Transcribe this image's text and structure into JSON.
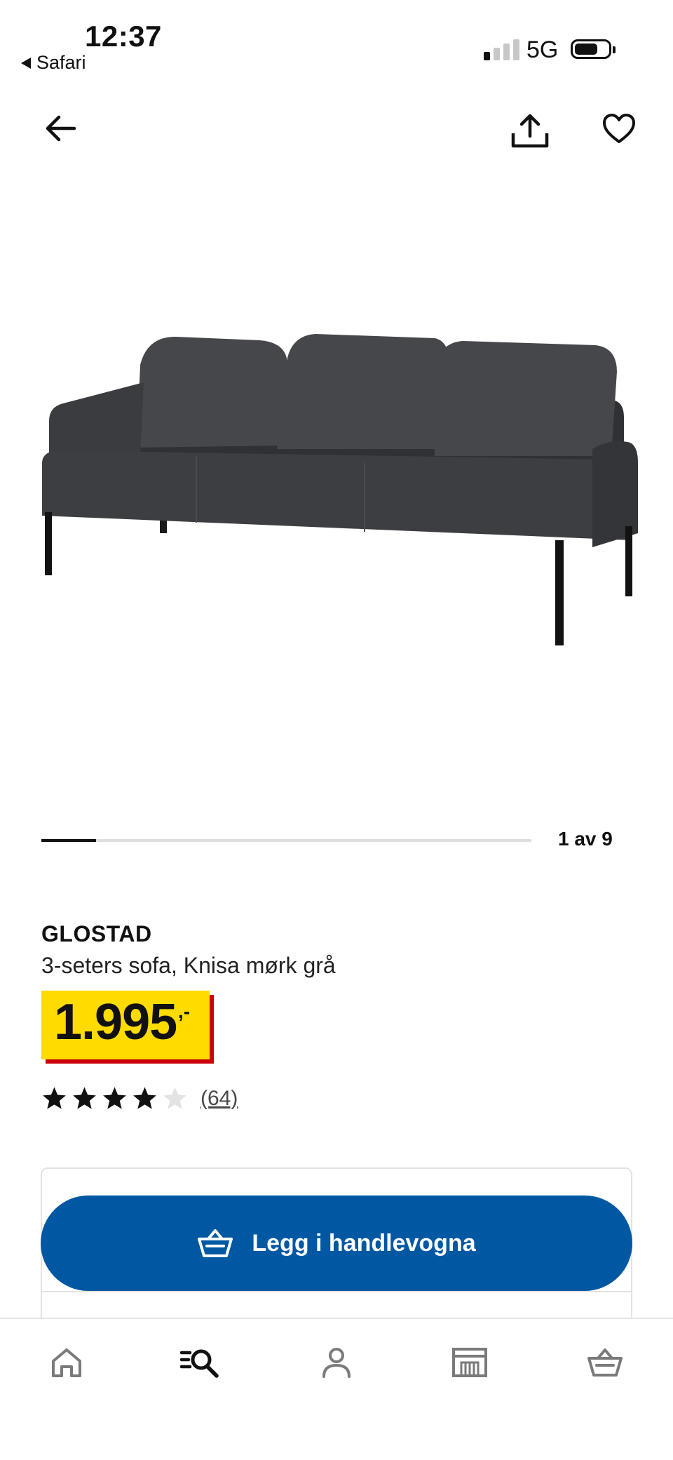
{
  "status_bar": {
    "time": "12:37",
    "back_app": "Safari",
    "network": "5G"
  },
  "nav": {
    "back_icon": "arrow-left-icon",
    "share_icon": "share-icon",
    "favorite_icon": "heart-icon"
  },
  "product": {
    "image_icon": "sofa-product-photo",
    "name": "GLOSTAD",
    "description": "3-seters sofa, Knisa mørk grå",
    "price": "1.995",
    "price_suffix": ",-",
    "rating": 4,
    "rating_max": 5,
    "review_count": "(64)"
  },
  "carousel": {
    "counter": "1 av 9",
    "current": 1,
    "total": 9
  },
  "cart": {
    "button_label": "Legg i handlevogna",
    "icon": "shopping-basket-icon"
  },
  "tabbar": {
    "items": [
      {
        "icon": "home-icon"
      },
      {
        "icon": "search-list-icon",
        "active": true
      },
      {
        "icon": "profile-icon"
      },
      {
        "icon": "store-icon"
      },
      {
        "icon": "basket-icon"
      }
    ]
  },
  "colors": {
    "accent_blue": "#0058a3",
    "price_yellow": "#ffdb00",
    "price_red": "#cc0008",
    "sofa_fabric": "#3b3d40"
  }
}
